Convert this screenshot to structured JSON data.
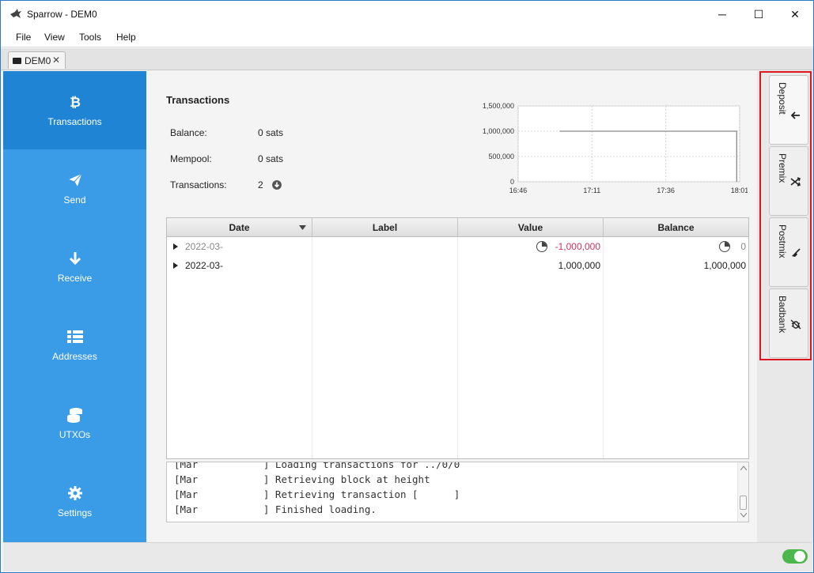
{
  "window": {
    "title": "Sparrow - DEM0",
    "minimize_icon": "─",
    "maximize_icon": "☐",
    "close_icon": "✕"
  },
  "menu": [
    "File",
    "View",
    "Tools",
    "Help"
  ],
  "tab": {
    "label": "DEM0",
    "close": "✕"
  },
  "sidebar": {
    "items": [
      {
        "label": "Transactions",
        "icon": "bitcoin-icon",
        "active": true
      },
      {
        "label": "Send",
        "icon": "paper-plane-icon"
      },
      {
        "label": "Receive",
        "icon": "arrow-down-icon"
      },
      {
        "label": "Addresses",
        "icon": "list-icon"
      },
      {
        "label": "UTXOs",
        "icon": "coins-icon"
      },
      {
        "label": "Settings",
        "icon": "gear-icon"
      }
    ],
    "active_color": "#1f84d4",
    "color": "#3a9be6"
  },
  "transactions": {
    "title": "Transactions",
    "balance_label": "Balance:",
    "balance_value": "0 sats",
    "mempool_label": "Mempool:",
    "mempool_value": "0 sats",
    "count_label": "Transactions:",
    "count_value": "2"
  },
  "chart_data": {
    "type": "line",
    "x_ticks": [
      "16:46",
      "17:11",
      "17:36",
      "18:01"
    ],
    "y_ticks": [
      "0",
      "500,000",
      "1,000,000",
      "1,500,000"
    ],
    "ylim": [
      0,
      1500000
    ],
    "series": [
      {
        "x": [
          "17:00",
          "18:00",
          "18:00"
        ],
        "y": [
          1000000,
          1000000,
          0
        ]
      }
    ],
    "grid": true
  },
  "table": {
    "columns": [
      "Date",
      "Label",
      "Value",
      "Balance"
    ],
    "rows": [
      {
        "date": "2022-03-",
        "label": "",
        "value": "-1,000,000",
        "balance": "0",
        "pending": true
      },
      {
        "date": "2022-03-",
        "label": "",
        "value": "1,000,000",
        "balance": "1,000,000",
        "pending": false
      }
    ],
    "negative_color": "#d0325a"
  },
  "log": {
    "lines": [
      "[Mar           ] Loading transactions for ../0/0",
      "[Mar           ] Retrieving block at height",
      "[Mar           ] Retrieving transaction [      ]",
      "[Mar           ] Finished loading."
    ]
  },
  "right_tabs": [
    "Deposit",
    "Premix",
    "Postmix",
    "Badbank"
  ],
  "highlight_color": "#e0141e",
  "status": {
    "toggle_on": true,
    "toggle_color": "#4cb84c"
  }
}
